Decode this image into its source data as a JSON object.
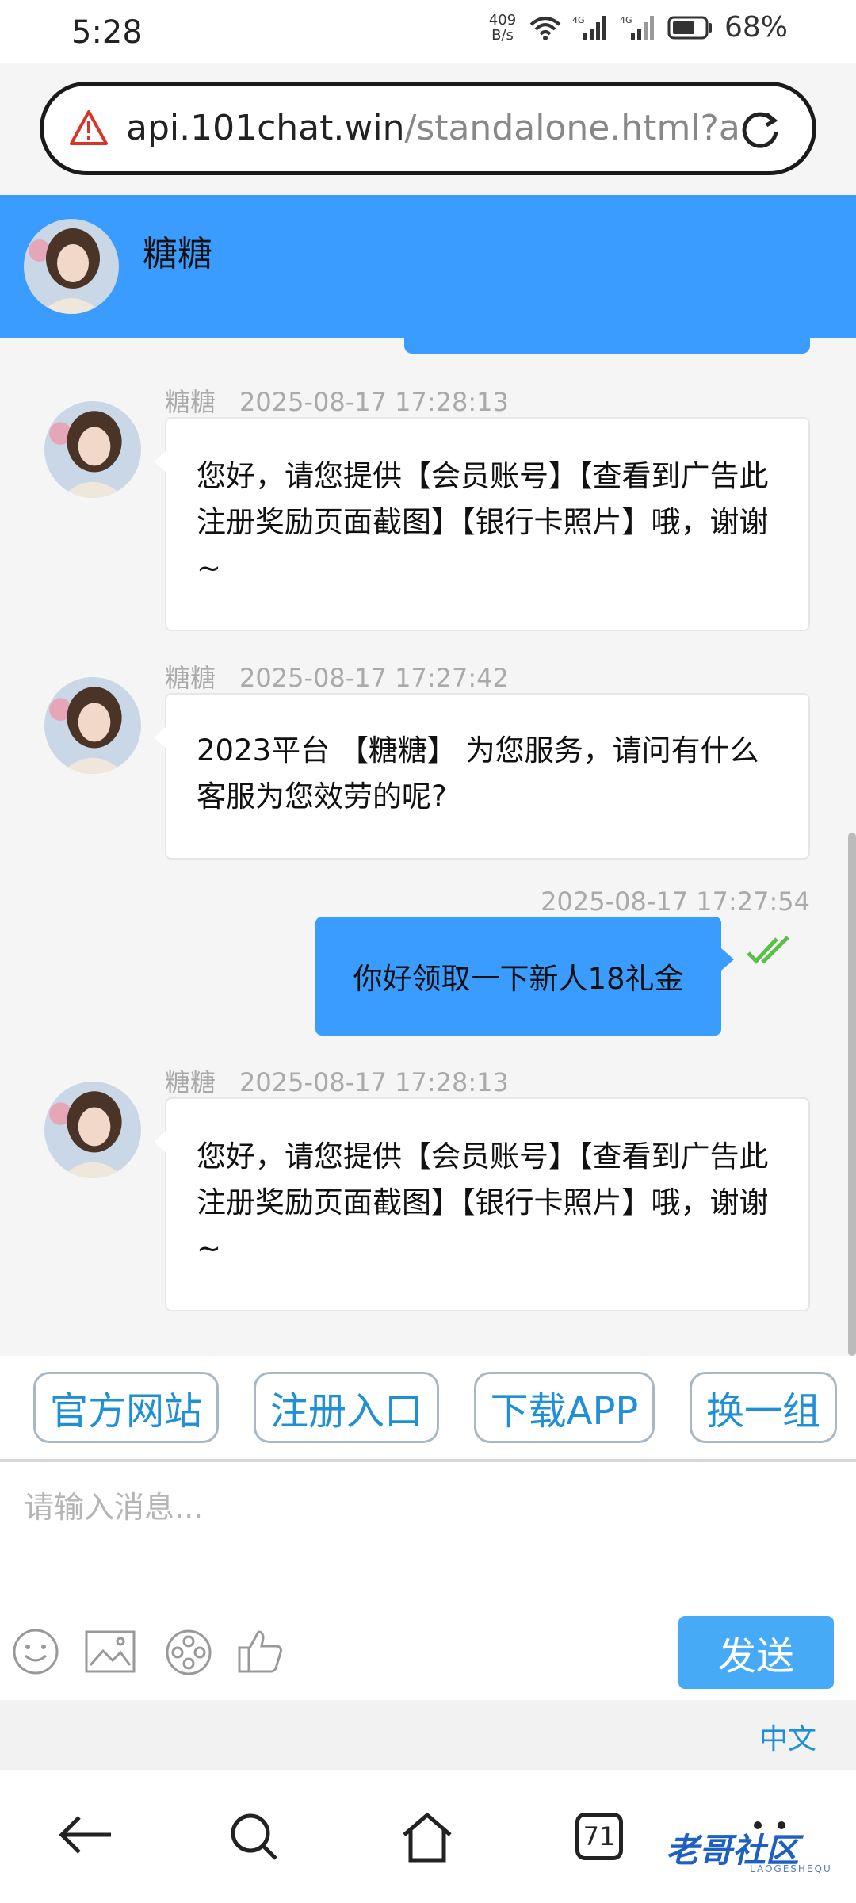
{
  "status_bar": {
    "time": "5:28",
    "net_speed": "409",
    "net_speed_unit": "B/s",
    "battery": "68%"
  },
  "browser": {
    "url_host": "api.101chat.win",
    "url_path": "/standalone.html?a"
  },
  "chat": {
    "agent_name": "糖糖",
    "messages": [
      {
        "sender": "糖糖",
        "time": "2025-08-17 17:28:13",
        "text": "您好，请您提供【会员账号】【查看到广告此注册奖励页面截图】【银行卡照片】哦，谢谢~"
      },
      {
        "sender": "糖糖",
        "time": "2025-08-17 17:27:42",
        "text": "2023平台 【糖糖】 为您服务，请问有什么客服为您效劳的呢?"
      },
      {
        "time": "2025-08-17 17:27:54",
        "text": "你好领取一下新人18礼金"
      },
      {
        "sender": "糖糖",
        "time": "2025-08-17 17:28:13",
        "text": "您好，请您提供【会员账号】【查看到广告此注册奖励页面截图】【银行卡照片】哦，谢谢~"
      }
    ]
  },
  "quick_replies": [
    "官方网站",
    "注册入口",
    "下载APP",
    "换一组"
  ],
  "composer": {
    "placeholder": "请输入消息...",
    "send_label": "发送"
  },
  "language": "中文",
  "nav": {
    "tab_count": "71",
    "watermark": "老哥社区",
    "watermark_sub": "LAOGESHEQU"
  },
  "colors": {
    "header_blue": "#3b9cff",
    "send_blue": "#47aaf7",
    "link_blue": "#1f8fd6"
  }
}
